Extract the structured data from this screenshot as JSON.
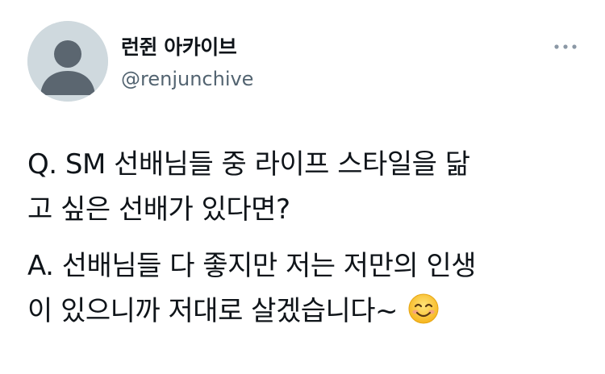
{
  "tweet": {
    "display_name": "런쥔 아카이브",
    "handle": "@renjunchive",
    "text_question": "Q. SM 선배님들 중 라이프 스타일을 닮\n고 싶은 선배가 있다면?",
    "text_answer": "A. 선배님들 다 좋지만 저는 저만의 인생\n이 있으니까 저대로 살겠습니다~",
    "emoji_icon": "smiling-face-emoji",
    "more_icon": "more-horizontal-icon",
    "avatar_icon": "default-avatar-icon"
  },
  "colors": {
    "text": "#0f1419",
    "secondary": "#536471",
    "avatar_bg": "#cfd9de",
    "avatar_fg": "#5b6670"
  }
}
